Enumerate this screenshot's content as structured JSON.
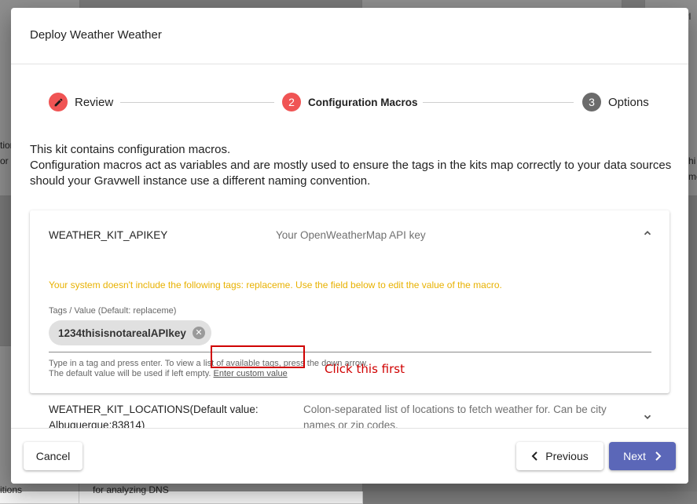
{
  "background": {
    "fragments": [
      "orl",
      "tion",
      "or",
      "hi",
      "me",
      "itions",
      "for analyzing DNS"
    ]
  },
  "dialog": {
    "title": "Deploy Weather Weather"
  },
  "stepper": {
    "steps": [
      {
        "label": "Review",
        "icon": "pencil-icon",
        "state": "completed"
      },
      {
        "number": "2",
        "label": "Configuration Macros",
        "state": "active"
      },
      {
        "number": "3",
        "label": "Options",
        "state": "pending"
      }
    ]
  },
  "intro": {
    "line1": "This kit contains configuration macros.",
    "line2": "Configuration macros act as variables and are mostly used to ensure the tags in the kits map correctly to your data sources should your Gravwell instance use a different naming convention."
  },
  "macros": [
    {
      "name": "WEATHER_KIT_APIKEY",
      "description": "Your OpenWeatherMap API key",
      "warning": "Your system doesn't include the following tags: replaceme. Use the field below to edit the value of the macro.",
      "field_label": "Tags / Value (Default: replaceme)",
      "chip_value": "1234thisisnotarealAPIkey",
      "helper_line1": "Type in a tag and press enter. To view a list of available tags, press the down arrow.",
      "helper_line2": "The default value will be used if left empty.",
      "custom_link": "Enter custom value"
    },
    {
      "name": "WEATHER_KIT_LOCATIONS(Default value: Albuquerque:83814)",
      "description": "Colon-separated list of locations to fetch weather for. Can be city names or zip codes."
    }
  ],
  "annotation": {
    "note": "Click this first",
    "color": "#d00000"
  },
  "footer": {
    "cancel": "Cancel",
    "previous": "Previous",
    "next": "Next"
  },
  "colors": {
    "accent": "#5b67b8",
    "step_active": "#f05454",
    "step_pending": "#6b6b6b",
    "warning": "#e8b100"
  }
}
